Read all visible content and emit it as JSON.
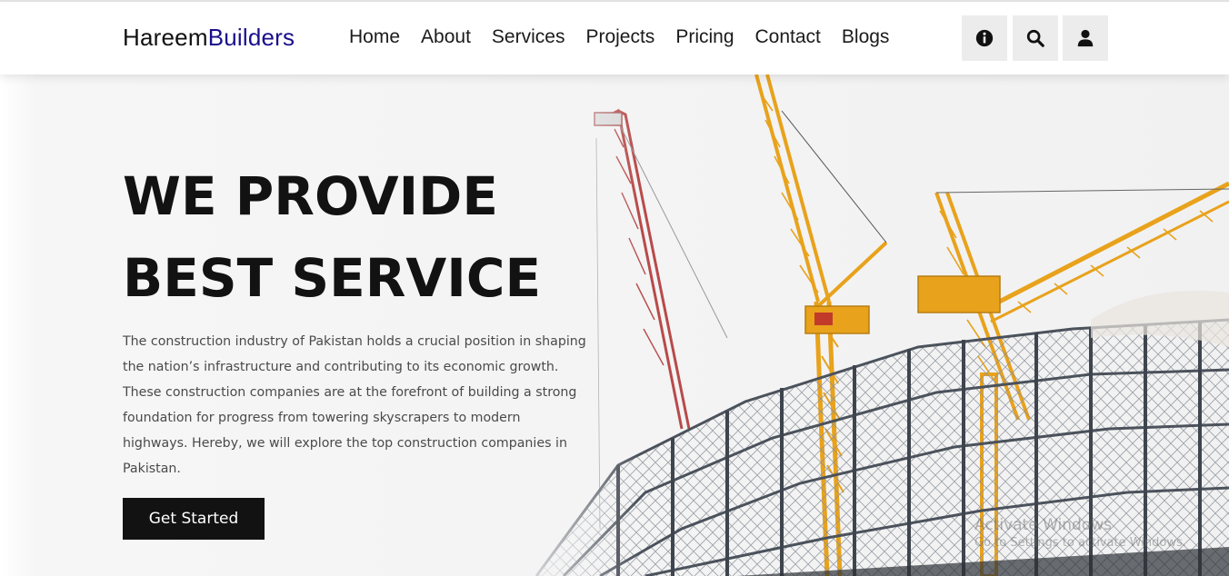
{
  "brand": {
    "part1": "Hareem",
    "part2": "Builders",
    "accent_color": "#1a0f8c"
  },
  "nav": {
    "items": [
      {
        "label": "Home"
      },
      {
        "label": "About"
      },
      {
        "label": "Services"
      },
      {
        "label": "Projects"
      },
      {
        "label": "Pricing"
      },
      {
        "label": "Contact"
      },
      {
        "label": "Blogs"
      }
    ]
  },
  "header_icons": [
    "info-icon",
    "search-icon",
    "user-icon"
  ],
  "hero": {
    "headline_line1": "WE PROVIDE",
    "headline_line2": "BEST SERVICE",
    "description": "The construction industry of Pakistan holds a crucial position in shaping the nation’s infrastructure and contributing to its economic growth. These construction companies are at the forefront of building a strong foundation for progress from towering skyscrapers to modern highways. Hereby, we will explore the top construction companies in Pakistan.",
    "cta_label": "Get Started"
  },
  "watermark": {
    "line1": "Activate Windows",
    "line2": "Go to Settings to activate Windows."
  },
  "colors": {
    "crane": "#e8a21b",
    "crane_red": "#c0392b",
    "steel": "#555b66",
    "button": "#121212"
  }
}
